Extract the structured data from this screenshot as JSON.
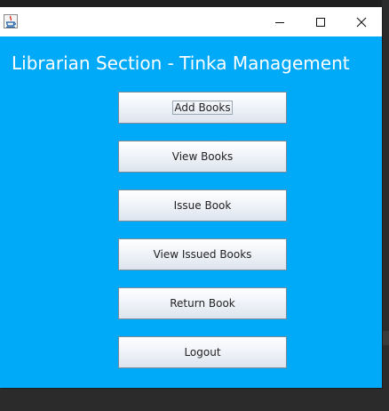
{
  "window": {
    "title": "",
    "icon": "java-cup-icon",
    "controls": [
      "minimize-icon",
      "maximize-icon",
      "close-icon"
    ]
  },
  "heading": "Librarian Section - Tinka Management",
  "buttons": [
    {
      "label": "Add Books",
      "focused": true
    },
    {
      "label": "View Books",
      "focused": false
    },
    {
      "label": "Issue Book",
      "focused": false
    },
    {
      "label": "View Issued Books",
      "focused": false
    },
    {
      "label": "Return Book",
      "focused": false
    },
    {
      "label": "Logout",
      "focused": false
    }
  ],
  "colors": {
    "window_background": "#00aaf8",
    "titlebar": "#ffffff",
    "heading_text": "#ffffff"
  }
}
